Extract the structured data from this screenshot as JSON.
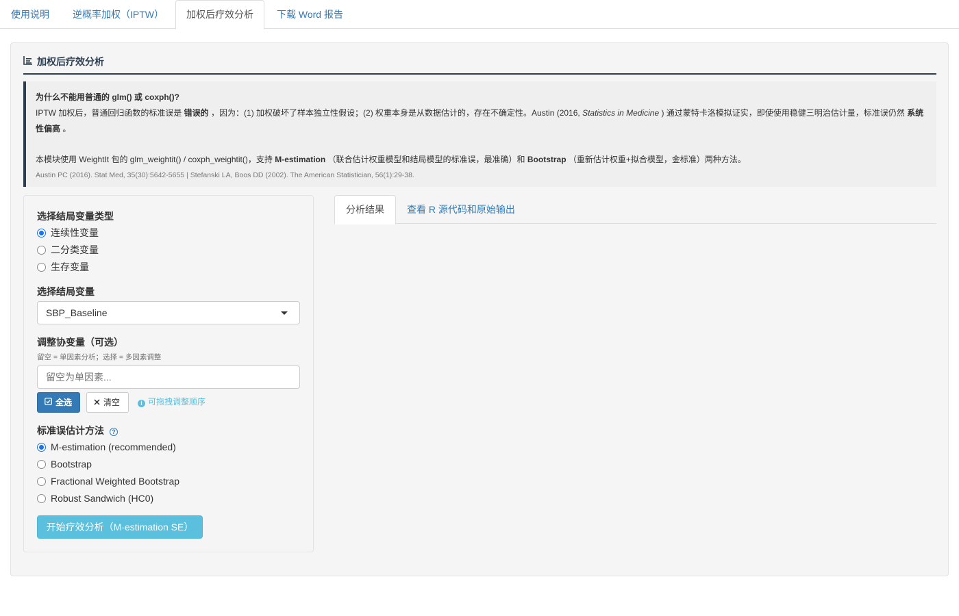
{
  "top_tabs": [
    "使用说明",
    "逆概率加权（IPTW）",
    "加权后疗效分析",
    "下载 Word 报告"
  ],
  "section": {
    "title": "加权后疗效分析",
    "title_icon": "list-chart-icon"
  },
  "callout": {
    "question": "为什么不能用普通的 glm() 或 coxph()?",
    "line1_a": "IPTW 加权后，普通回归函数的标准误是 ",
    "line1_strong": "错误的",
    "line1_b": " ，因为：(1) 加权破坏了样本独立性假设；(2) 权重本身是从数据估计的，存在不确定性。Austin (2016, ",
    "line1_em": "Statistics in Medicine",
    "line1_c": " ) 通过蒙特卡洛模拟证实，即使使用稳健三明治估计量，标准误仍然 ",
    "line1_strong2": "系统性偏高",
    "line1_d": " 。",
    "line2_a": "本模块使用 WeightIt 包的 glm_weightit() / coxph_weightit()，支持 ",
    "line2_strong1": "M-estimation",
    "line2_b": " （联合估计权重模型和结局模型的标准误，最准确）和 ",
    "line2_strong2": "Bootstrap",
    "line2_c": " （重新估计权重+拟合模型，金标准）两种方法。",
    "reference": "Austin PC (2016). Stat Med, 35(30):5642-5655 | Stefanski LA, Boos DD (2002). The American Statistician, 56(1):29-38."
  },
  "form": {
    "outcome_type_label": "选择结局变量类型",
    "outcome_types": [
      "连续性变量",
      "二分类变量",
      "生存变量"
    ],
    "outcome_type_selected": "连续性变量",
    "outcome_var_label": "选择结局变量",
    "outcome_var_value": "SBP_Baseline",
    "covariates_label": "调整协变量（可选）",
    "covariates_help": "留空 = 单因素分析；选择 = 多因素调整",
    "covariates_placeholder": "留空为单因素...",
    "select_all_label": "全选",
    "clear_label": "清空",
    "drag_hint": "可拖拽调整顺序",
    "se_method_label": "标准误估计方法",
    "se_methods": [
      "M-estimation (recommended)",
      "Bootstrap",
      "Fractional Weighted Bootstrap",
      "Robust Sandwich (HC0)"
    ],
    "se_method_selected": "M-estimation (recommended)",
    "run_button": "开始疗效分析（M-estimation SE）"
  },
  "result_tabs": [
    "分析结果",
    "查看 R 源代码和原始输出"
  ],
  "result_tab_active": "分析结果",
  "colors": {
    "primary": "#337ab7",
    "info": "#5bc0de",
    "heading": "#2c3e50"
  }
}
